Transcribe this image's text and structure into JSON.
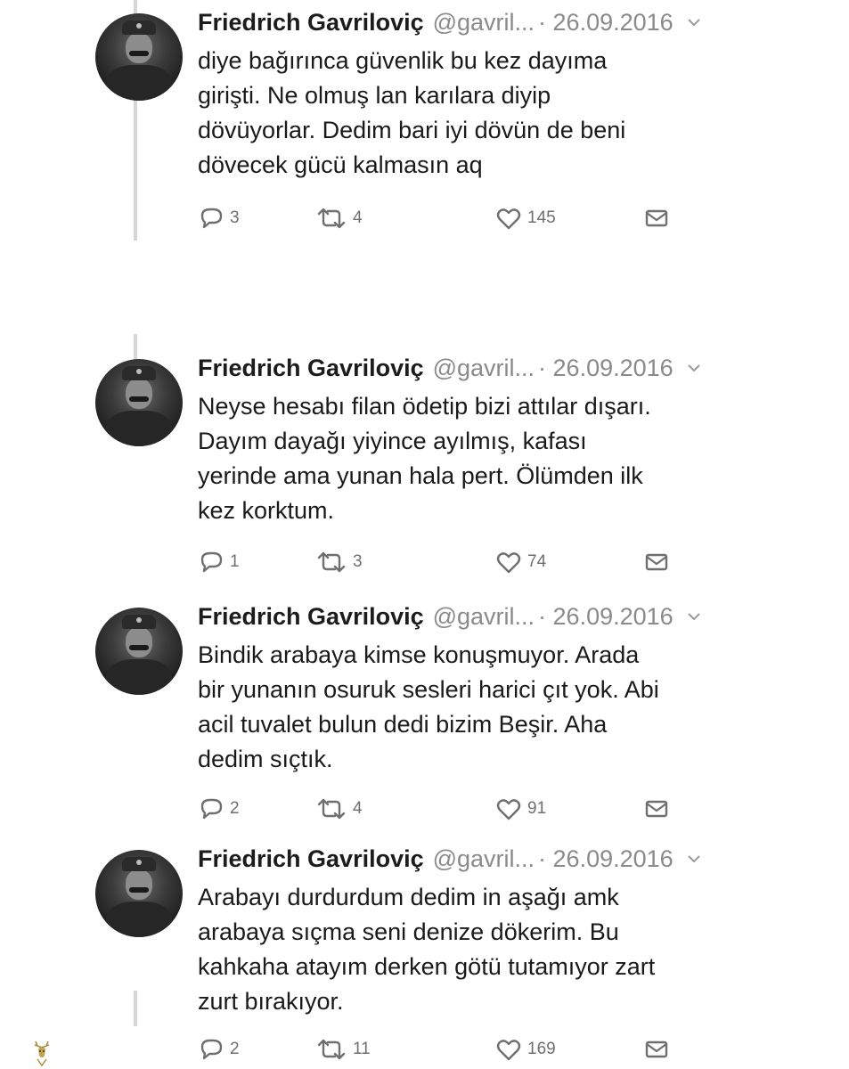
{
  "tweets": [
    {
      "author": "Friedrich Gavriloviç",
      "handle": "@gavril...",
      "date": "· 26.09.2016",
      "lines": [
        "diye bağırınca güvenlik bu kez dayıma",
        "girişti. Ne olmuş lan karılara diyip",
        "dövüyorlar. Dedim bari iyi dövün de beni",
        "dövecek gücü kalmasın aq"
      ],
      "replies": "3",
      "retweets": "4",
      "likes": "145"
    },
    {
      "author": "Friedrich Gavriloviç",
      "handle": "@gavril...",
      "date": "· 26.09.2016",
      "lines": [
        "Neyse hesabı filan ödetip bizi attılar dışarı.",
        "Dayım dayağı yiyince ayılmış, kafası",
        "yerinde ama yunan hala pert. Ölümden ilk",
        "kez korktum."
      ],
      "replies": "1",
      "retweets": "3",
      "likes": "74"
    },
    {
      "author": "Friedrich Gavriloviç",
      "handle": "@gavril...",
      "date": "· 26.09.2016",
      "lines": [
        "Bindik arabaya kimse konuşmuyor. Arada",
        "bir yunanın osuruk sesleri harici çıt yok. Abi",
        "acil tuvalet bulun dedi bizim Beşir. Aha",
        "dedim sıçtık."
      ],
      "replies": "2",
      "retweets": "4",
      "likes": "91"
    },
    {
      "author": "Friedrich Gavriloviç",
      "handle": "@gavril...",
      "date": "· 26.09.2016",
      "lines": [
        "Arabayı durdurdum dedim in aşağı amk",
        "arabaya sıçma seni denize dökerim. Bu",
        "kahkaha atayım derken götü tutamıyor zart",
        "zurt bırakıyor."
      ],
      "replies": "2",
      "retweets": "11",
      "likes": "169"
    }
  ],
  "icons": {
    "reply": "reply-icon",
    "retweet": "retweet-icon",
    "like": "heart-icon",
    "dm": "envelope-icon",
    "caret": "chevron-down-icon",
    "watermark": "deer-logo-icon"
  },
  "colors": {
    "text": "#1a1a1a",
    "muted": "#8a8a8a",
    "icon": "#6f6f6f",
    "thread_line": "#d6d6d6"
  }
}
